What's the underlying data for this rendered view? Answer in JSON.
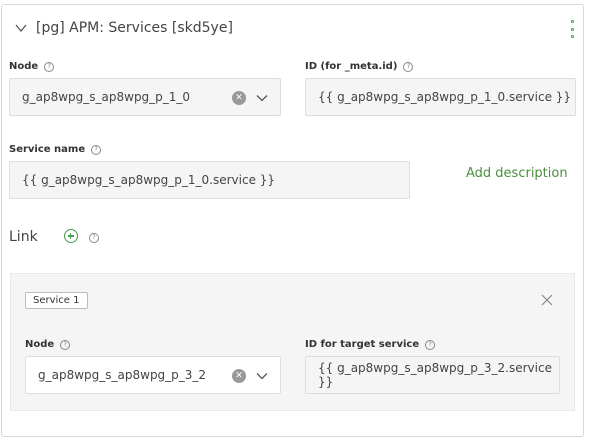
{
  "header": {
    "title": "[pg] APM: Services [skd5ye]"
  },
  "node_field": {
    "label": "Node",
    "value": "g_ap8wpg_s_ap8wpg_p_1_0"
  },
  "id_field": {
    "label": "ID (for _meta.id)",
    "value": "{{ g_ap8wpg_s_ap8wpg_p_1_0.service }}"
  },
  "service_name_field": {
    "label": "Service name",
    "value": "{{ g_ap8wpg_s_ap8wpg_p_1_0.service }}"
  },
  "add_description": "Add description",
  "link": {
    "label": "Link"
  },
  "service_item": {
    "tag": "Service 1",
    "node_label": "Node",
    "node_value": "g_ap8wpg_s_ap8wpg_p_3_2",
    "target_label": "ID for target service",
    "target_value": "{{ g_ap8wpg_s_ap8wpg_p_3_2.service }}"
  },
  "colors": {
    "accent": "#4a8f3e",
    "field_bg": "#f5f5f5",
    "border": "#dddddd"
  }
}
